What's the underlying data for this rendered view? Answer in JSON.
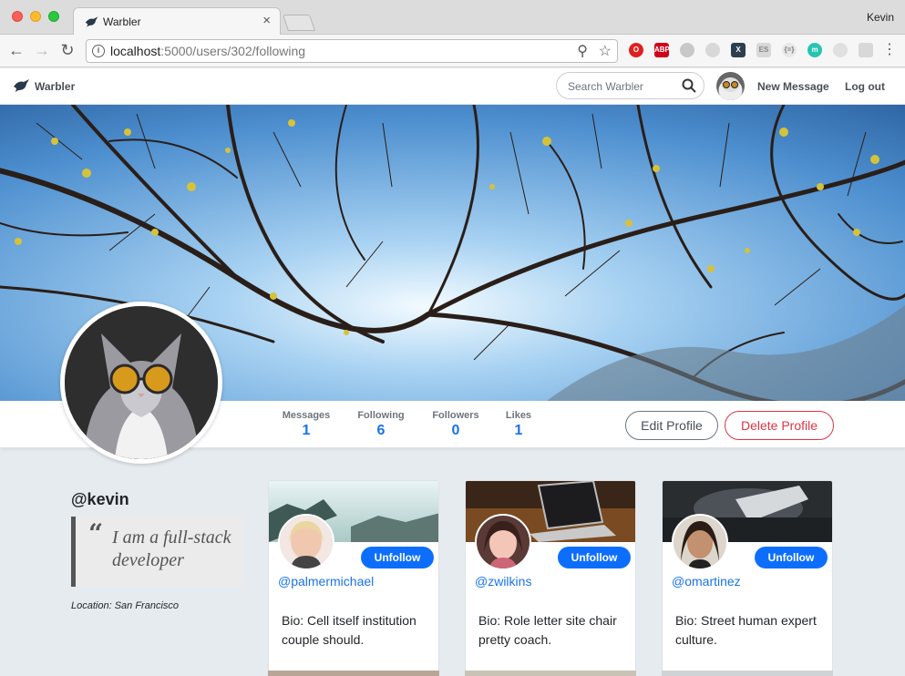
{
  "browser": {
    "tab_title": "Warbler",
    "tab_close": "×",
    "profile_name": "Kevin",
    "url_host": "localhost",
    "url_rest": ":5000/users/302/following"
  },
  "nav": {
    "brand": "Warbler",
    "search_placeholder": "Search Warbler",
    "new_message": "New Message",
    "logout": "Log out"
  },
  "profile": {
    "stats": [
      {
        "label": "Messages",
        "value": "1"
      },
      {
        "label": "Following",
        "value": "6"
      },
      {
        "label": "Followers",
        "value": "0"
      },
      {
        "label": "Likes",
        "value": "1"
      }
    ],
    "edit_label": "Edit Profile",
    "delete_label": "Delete Profile",
    "username": "@kevin",
    "bio_line1": "I am a full-stack",
    "bio_line2": "developer",
    "location": "Location: San Francisco"
  },
  "following": [
    {
      "handle": "@palmermichael",
      "bio": "Bio: Cell itself institution couple should.",
      "unfollow": "Unfollow"
    },
    {
      "handle": "@zwilkins",
      "bio": "Bio: Role letter site chair pretty coach.",
      "unfollow": "Unfollow"
    },
    {
      "handle": "@omartinez",
      "bio": "Bio: Street human expert culture.",
      "unfollow": "Unfollow"
    }
  ],
  "colors": {
    "accent": "#0d6efd",
    "link": "#1a73e8",
    "danger": "#dc3545",
    "page_bg": "#e6ebf0"
  }
}
